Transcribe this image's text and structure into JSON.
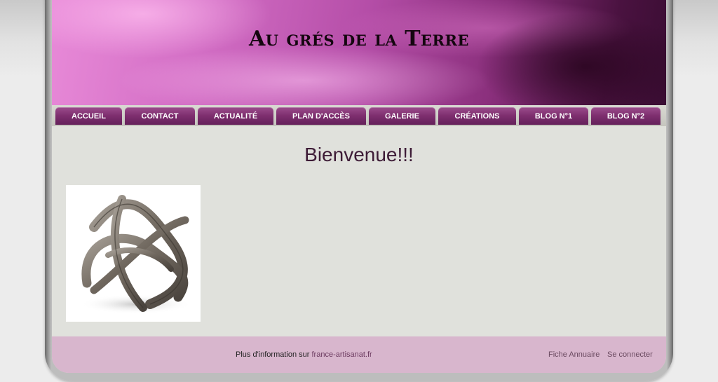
{
  "header": {
    "title": "Au grés de la Terre"
  },
  "nav": {
    "items": [
      {
        "label": "ACCUEIL"
      },
      {
        "label": "CONTACT"
      },
      {
        "label": "ACTUALITÉ"
      },
      {
        "label": "PLAN D'ACCÈS"
      },
      {
        "label": "GALERIE"
      },
      {
        "label": "CRÉATIONS"
      },
      {
        "label": "BLOG N°1"
      },
      {
        "label": "BLOG N°2"
      }
    ]
  },
  "main": {
    "heading": "Bienvenue!!!"
  },
  "footer": {
    "info_prefix": "Plus d'information sur",
    "info_link": "france-artisanat.fr",
    "directory_link": "Fiche Annuaire",
    "login_link": "Se connecter"
  }
}
